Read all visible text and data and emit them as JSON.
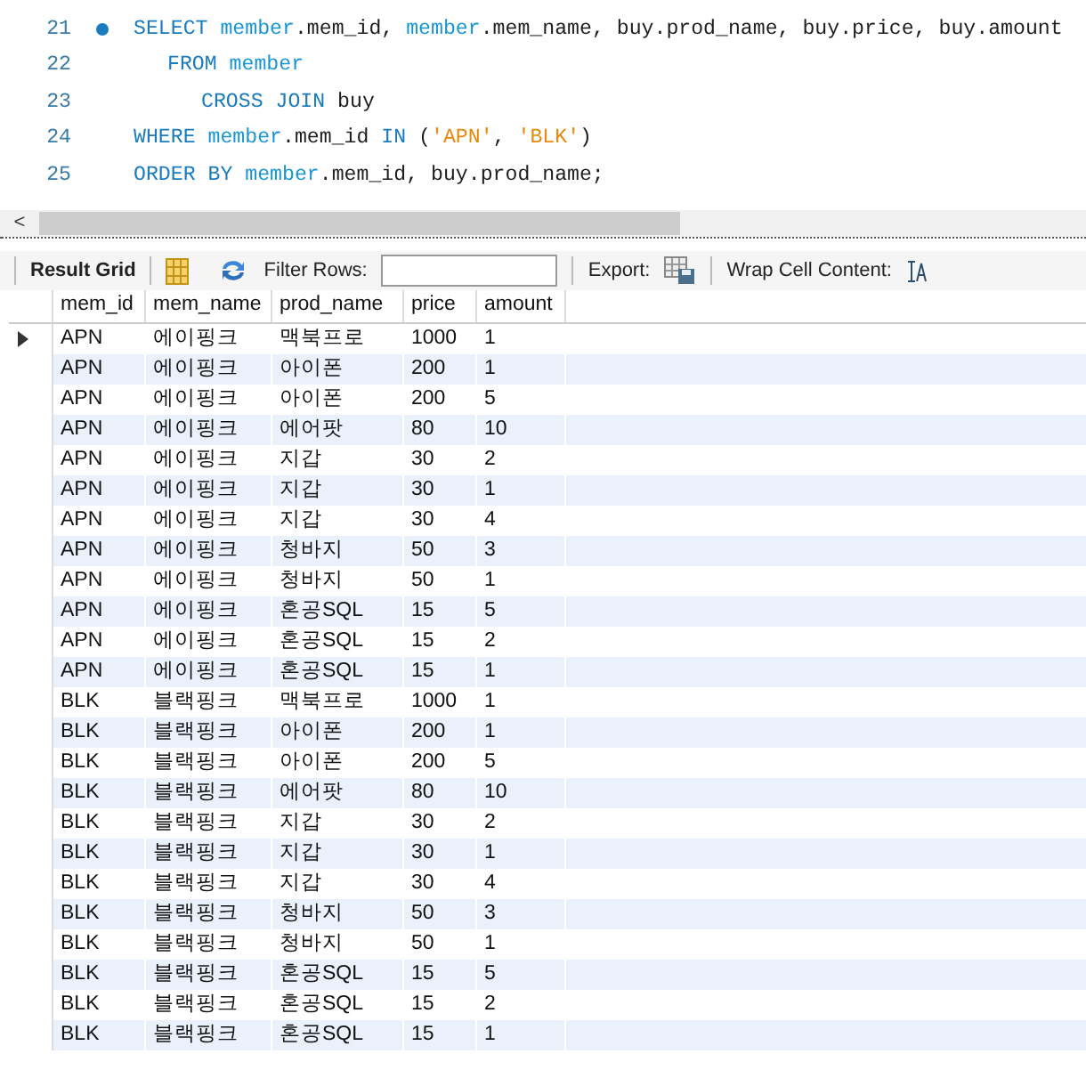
{
  "editor": {
    "lines": [
      {
        "number": "21",
        "breakpoint": true,
        "kind": "statement",
        "tokens": [
          {
            "kind": "keyword",
            "text": "SELECT "
          },
          {
            "kind": "ident",
            "text": "member"
          },
          {
            "kind": "plain",
            "text": ".mem_id, "
          },
          {
            "kind": "ident",
            "text": "member"
          },
          {
            "kind": "plain",
            "text": ".mem_name, buy.prod_name, buy.price, buy.amount"
          }
        ]
      },
      {
        "number": "22",
        "breakpoint": false,
        "kind": "clause",
        "tokens": [
          {
            "kind": "keyword",
            "text": "FROM "
          },
          {
            "kind": "ident",
            "text": "member"
          }
        ]
      },
      {
        "number": "23",
        "breakpoint": false,
        "kind": "join",
        "tokens": [
          {
            "kind": "keyword",
            "text": "CROSS JOIN "
          },
          {
            "kind": "plain",
            "text": "buy"
          }
        ]
      },
      {
        "number": "24",
        "breakpoint": false,
        "kind": "statement",
        "tokens": [
          {
            "kind": "keyword",
            "text": "WHERE "
          },
          {
            "kind": "ident",
            "text": "member"
          },
          {
            "kind": "plain",
            "text": ".mem_id "
          },
          {
            "kind": "keyword",
            "text": "IN "
          },
          {
            "kind": "plain",
            "text": "("
          },
          {
            "kind": "string",
            "text": "'APN'"
          },
          {
            "kind": "plain",
            "text": ", "
          },
          {
            "kind": "string",
            "text": "'BLK'"
          },
          {
            "kind": "plain",
            "text": ")"
          }
        ]
      },
      {
        "number": "25",
        "breakpoint": false,
        "kind": "statement",
        "tokens": [
          {
            "kind": "keyword",
            "text": "ORDER BY "
          },
          {
            "kind": "ident",
            "text": "member"
          },
          {
            "kind": "plain",
            "text": ".mem_id, buy.prod_name;"
          }
        ]
      }
    ],
    "scroll_left": "<"
  },
  "toolbar": {
    "result_grid": "Result Grid",
    "filter_label": "Filter Rows:",
    "export_label": "Export:",
    "wrap_label": "Wrap Cell Content:"
  },
  "table": {
    "columns": [
      "mem_id",
      "mem_name",
      "prod_name",
      "price",
      "amount"
    ],
    "rows": [
      {
        "selected": true,
        "cells": [
          "APN",
          "에이핑크",
          "맥북프로",
          "1000",
          "1"
        ]
      },
      {
        "selected": false,
        "cells": [
          "APN",
          "에이핑크",
          "아이폰",
          "200",
          "1"
        ]
      },
      {
        "selected": false,
        "cells": [
          "APN",
          "에이핑크",
          "아이폰",
          "200",
          "5"
        ]
      },
      {
        "selected": false,
        "cells": [
          "APN",
          "에이핑크",
          "에어팟",
          "80",
          "10"
        ]
      },
      {
        "selected": false,
        "cells": [
          "APN",
          "에이핑크",
          "지갑",
          "30",
          "2"
        ]
      },
      {
        "selected": false,
        "cells": [
          "APN",
          "에이핑크",
          "지갑",
          "30",
          "1"
        ]
      },
      {
        "selected": false,
        "cells": [
          "APN",
          "에이핑크",
          "지갑",
          "30",
          "4"
        ]
      },
      {
        "selected": false,
        "cells": [
          "APN",
          "에이핑크",
          "청바지",
          "50",
          "3"
        ]
      },
      {
        "selected": false,
        "cells": [
          "APN",
          "에이핑크",
          "청바지",
          "50",
          "1"
        ]
      },
      {
        "selected": false,
        "cells": [
          "APN",
          "에이핑크",
          "혼공SQL",
          "15",
          "5"
        ]
      },
      {
        "selected": false,
        "cells": [
          "APN",
          "에이핑크",
          "혼공SQL",
          "15",
          "2"
        ]
      },
      {
        "selected": false,
        "cells": [
          "APN",
          "에이핑크",
          "혼공SQL",
          "15",
          "1"
        ]
      },
      {
        "selected": false,
        "cells": [
          "BLK",
          "블랙핑크",
          "맥북프로",
          "1000",
          "1"
        ]
      },
      {
        "selected": false,
        "cells": [
          "BLK",
          "블랙핑크",
          "아이폰",
          "200",
          "1"
        ]
      },
      {
        "selected": false,
        "cells": [
          "BLK",
          "블랙핑크",
          "아이폰",
          "200",
          "5"
        ]
      },
      {
        "selected": false,
        "cells": [
          "BLK",
          "블랙핑크",
          "에어팟",
          "80",
          "10"
        ]
      },
      {
        "selected": false,
        "cells": [
          "BLK",
          "블랙핑크",
          "지갑",
          "30",
          "2"
        ]
      },
      {
        "selected": false,
        "cells": [
          "BLK",
          "블랙핑크",
          "지갑",
          "30",
          "1"
        ]
      },
      {
        "selected": false,
        "cells": [
          "BLK",
          "블랙핑크",
          "지갑",
          "30",
          "4"
        ]
      },
      {
        "selected": false,
        "cells": [
          "BLK",
          "블랙핑크",
          "청바지",
          "50",
          "3"
        ]
      },
      {
        "selected": false,
        "cells": [
          "BLK",
          "블랙핑크",
          "청바지",
          "50",
          "1"
        ]
      },
      {
        "selected": false,
        "cells": [
          "BLK",
          "블랙핑크",
          "혼공SQL",
          "15",
          "5"
        ]
      },
      {
        "selected": false,
        "cells": [
          "BLK",
          "블랙핑크",
          "혼공SQL",
          "15",
          "2"
        ]
      },
      {
        "selected": false,
        "cells": [
          "BLK",
          "블랙핑크",
          "혼공SQL",
          "15",
          "1"
        ]
      }
    ]
  }
}
